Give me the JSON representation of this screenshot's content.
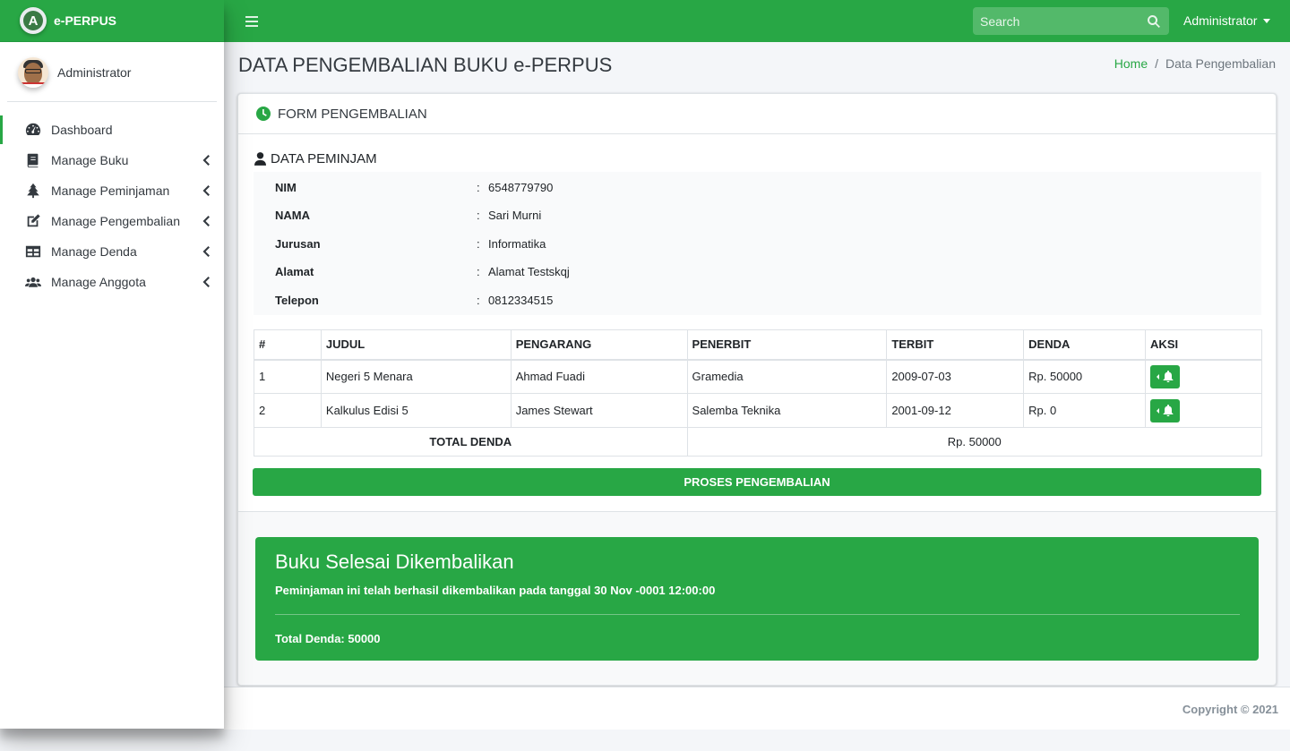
{
  "brand": {
    "name": "e-PERPUS",
    "logo_letter": "A"
  },
  "user": {
    "name": "Administrator"
  },
  "sidebar": {
    "items": [
      {
        "label": "Dashboard",
        "icon": "tachometer-icon",
        "active": true
      },
      {
        "label": "Manage Buku",
        "icon": "book-icon"
      },
      {
        "label": "Manage Peminjaman",
        "icon": "tree-icon"
      },
      {
        "label": "Manage Pengembalian",
        "icon": "edit-icon"
      },
      {
        "label": "Manage Denda",
        "icon": "table-icon"
      },
      {
        "label": "Manage Anggota",
        "icon": "users-icon"
      }
    ]
  },
  "topbar": {
    "search_placeholder": "Search",
    "admin_label": "Administrator"
  },
  "header": {
    "title": "DATA PENGEMBALIAN BUKU e-PERPUS"
  },
  "breadcrumb": {
    "home": "Home",
    "separator": "/",
    "current": "Data Pengembalian"
  },
  "card": {
    "title": "FORM PENGEMBALIAN"
  },
  "peminjam": {
    "title": "DATA PEMINJAM",
    "rows": [
      {
        "label": "NIM",
        "value": "6548779790"
      },
      {
        "label": "NAMA",
        "value": "Sari Murni"
      },
      {
        "label": "Jurusan",
        "value": "Informatika"
      },
      {
        "label": "Alamat",
        "value": "Alamat Testskqj"
      },
      {
        "label": "Telepon",
        "value": "0812334515"
      }
    ]
  },
  "books_table": {
    "headers": [
      "#",
      "JUDUL",
      "PENGARANG",
      "PENERBIT",
      "TERBIT",
      "DENDA",
      "AKSI"
    ],
    "rows": [
      {
        "no": "1",
        "judul": "Negeri 5 Menara",
        "pengarang": "Ahmad Fuadi",
        "penerbit": "Gramedia",
        "terbit": "2009-07-03",
        "denda": "Rp. 50000"
      },
      {
        "no": "2",
        "judul": "Kalkulus Edisi 5",
        "pengarang": "James Stewart",
        "penerbit": "Salemba Teknika",
        "terbit": "2001-09-12",
        "denda": "Rp. 0"
      }
    ],
    "total_label": "TOTAL DENDA",
    "total_value": "Rp. 50000"
  },
  "proses_button": "PROSES PENGEMBALIAN",
  "alert": {
    "title": "Buku Selesai Dikembalikan",
    "message": "Peminjaman ini telah berhasil dikembalikan pada tanggal 30 Nov -0001 12:00:00",
    "total": "Total Denda: 50000"
  },
  "footer": {
    "copyright": "Copyright © 2021"
  },
  "colors": {
    "primary": "#28a745",
    "sidebar_bg": "#ffffff",
    "content_bg": "#f4f6f9"
  }
}
